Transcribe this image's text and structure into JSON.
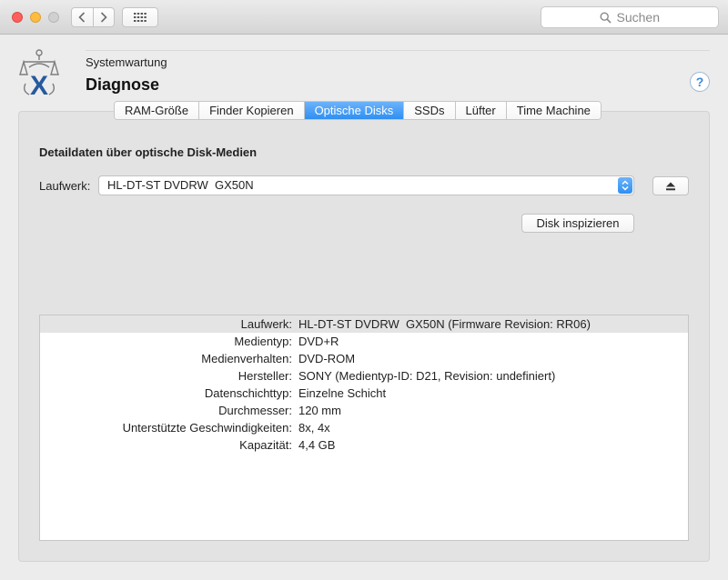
{
  "titlebar": {
    "search_placeholder": "Suchen",
    "back_icon": "chevron-left-icon",
    "forward_icon": "chevron-right-icon",
    "grid_icon": "grid-icon"
  },
  "header": {
    "subtitle": "Systemwartung",
    "title": "Diagnose",
    "help_label": "?"
  },
  "tabs": [
    {
      "label": "RAM-Größe",
      "active": false
    },
    {
      "label": "Finder Kopieren",
      "active": false
    },
    {
      "label": "Optische Disks",
      "active": true
    },
    {
      "label": "SSDs",
      "active": false
    },
    {
      "label": "Lüfter",
      "active": false
    },
    {
      "label": "Time Machine",
      "active": false
    }
  ],
  "main": {
    "section_title": "Detaildaten über optische Disk-Medien",
    "drive_label": "Laufwerk:",
    "drive_value": "HL-DT-ST DVDRW  GX50N",
    "inspect_button": "Disk inspizieren"
  },
  "details": [
    {
      "key": "Laufwerk:",
      "value": "HL-DT-ST DVDRW  GX50N (Firmware Revision: RR06)"
    },
    {
      "key": "Medientyp:",
      "value": "DVD+R"
    },
    {
      "key": "Medienverhalten:",
      "value": "DVD-ROM"
    },
    {
      "key": "Hersteller:",
      "value": "SONY (Medientyp-ID: D21, Revision: undefiniert)"
    },
    {
      "key": "Datenschichttyp:",
      "value": "Einzelne Schicht"
    },
    {
      "key": "Durchmesser:",
      "value": "120 mm"
    },
    {
      "key": "Unterstützte Geschwindigkeiten:",
      "value": "8x, 4x"
    },
    {
      "key": "Kapazität:",
      "value": "4,4 GB"
    }
  ],
  "colors": {
    "accent": "#2f8ff2",
    "close": "#fc605c",
    "minimize": "#fdbc40"
  }
}
